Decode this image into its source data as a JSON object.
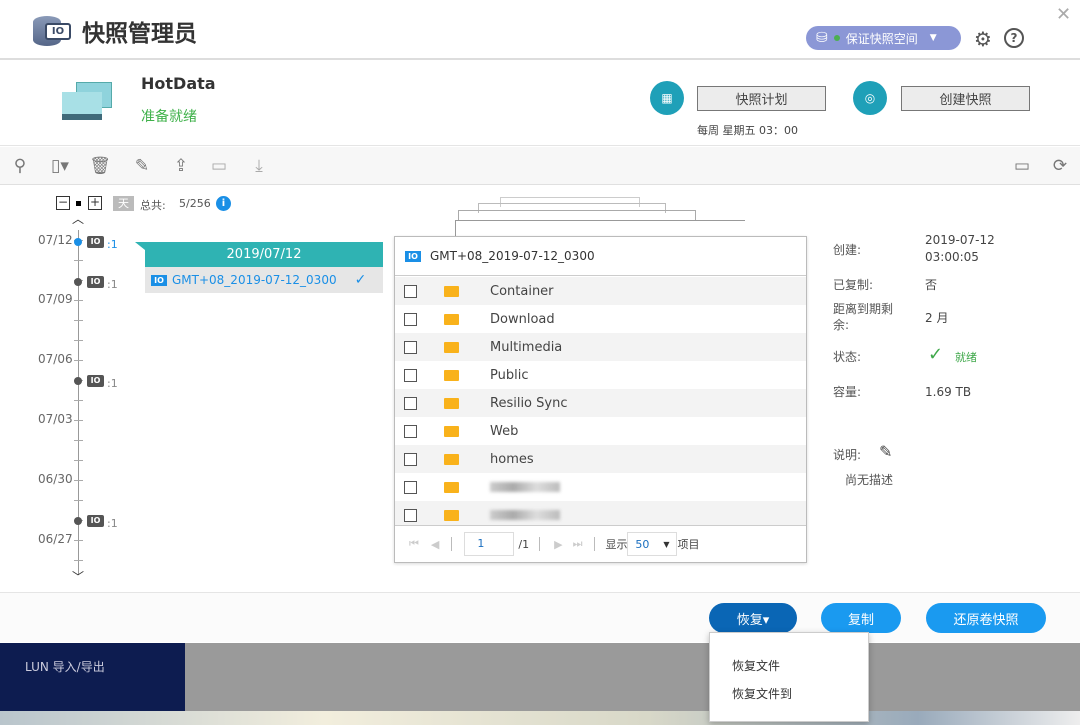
{
  "app": {
    "title": "快照管理员",
    "logo_text": "IO"
  },
  "header": {
    "space_label": "保证快照空间",
    "status_color": "#4caf50"
  },
  "volume": {
    "name": "HotData",
    "status": "准备就绪",
    "status_color": "#3fb14a"
  },
  "actions": {
    "schedule_label": "快照计划",
    "schedule_text": "每周 星期五 03：00",
    "create_label": "创建快照"
  },
  "timeline": {
    "day_label": "天",
    "total_label": "总共:",
    "total_value": "5/256",
    "dates": [
      "07/12",
      "07/09",
      "07/06",
      "07/03",
      "06/30",
      "06/27"
    ],
    "counts": [
      ":1",
      ":1",
      ":1",
      ":1"
    ]
  },
  "snapshot_popup": {
    "date": "2019/07/12",
    "name": "GMT+08_2019-07-12_0300"
  },
  "file_panel": {
    "title": "GMT+08_2019-07-12_0300",
    "items": [
      "Container",
      "Download",
      "Multimedia",
      "Public",
      "Resilio Sync",
      "Web",
      "homes"
    ],
    "pagination": {
      "page": "1",
      "of": "/1",
      "show_label": "显示",
      "per_page": "50",
      "items_label": "项目"
    }
  },
  "details": {
    "created_label": "创建:",
    "created_value": "2019-07-12 03:00:05",
    "copied_label": "已复制:",
    "copied_value": "否",
    "expire_label": "距离到期剩余:",
    "expire_value": "2 月",
    "state_label": "状态:",
    "state_value": "就绪",
    "capacity_label": "容量:",
    "capacity_value": "1.69 TB",
    "desc_label": "说明:",
    "desc_value": "尚无描述"
  },
  "footer": {
    "restore_label": "恢复▾",
    "copy_label": "复制",
    "revert_label": "还原卷快照"
  },
  "restore_menu": [
    "恢复文件",
    "恢复文件到"
  ],
  "background": {
    "sidebar_item": "LUN 导入/导出"
  }
}
